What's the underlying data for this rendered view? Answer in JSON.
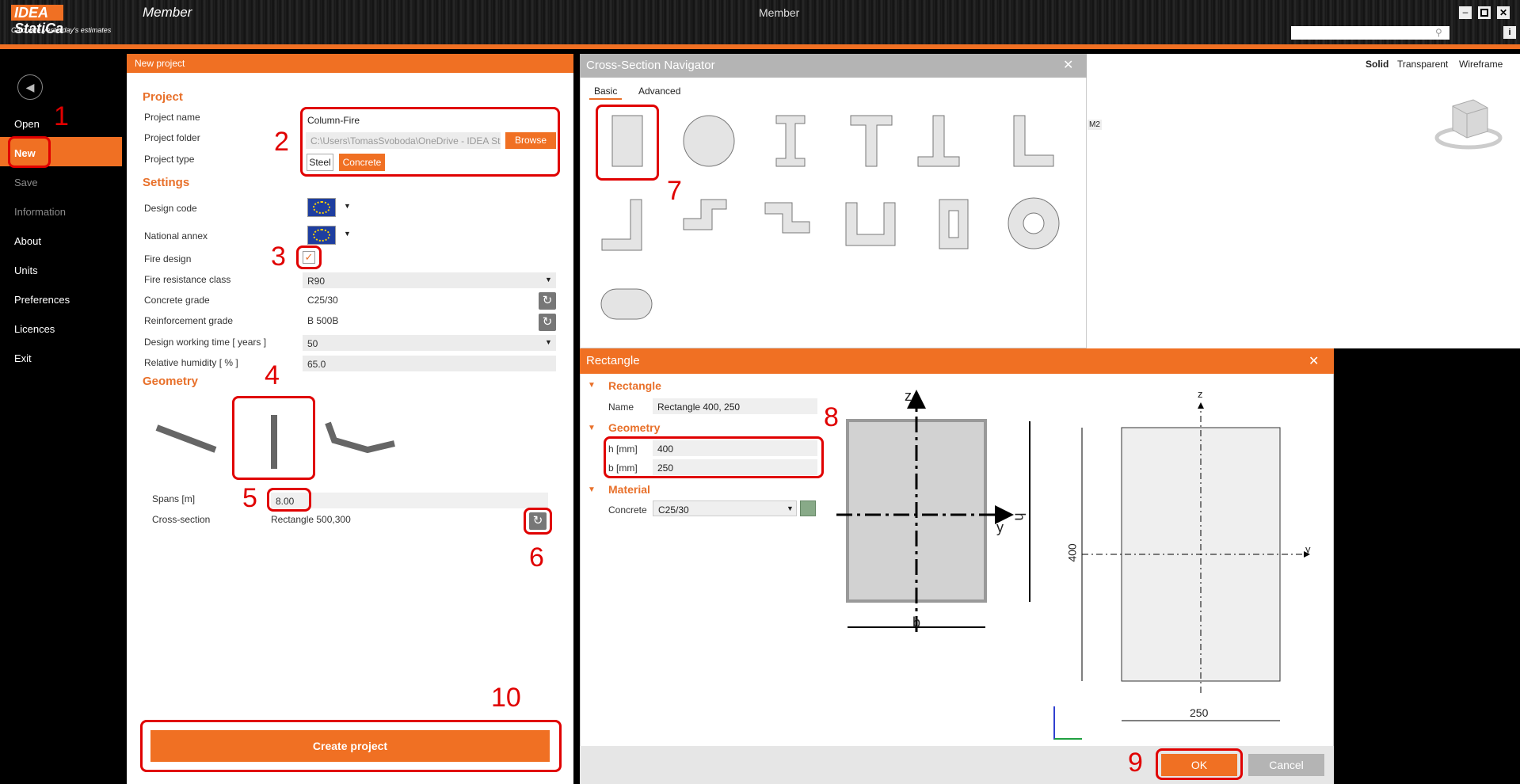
{
  "app": {
    "logo": "IDEA StatiCa",
    "module": "Member",
    "tagline": "Calculate yesterday's estimates",
    "window_title": "Member"
  },
  "sidebar": {
    "items": [
      {
        "label": "Open",
        "enabled": true
      },
      {
        "label": "New",
        "enabled": true,
        "selected": true
      },
      {
        "label": "Save",
        "enabled": false
      },
      {
        "label": "Information",
        "enabled": false
      },
      {
        "label": "About",
        "enabled": true
      },
      {
        "label": "Units",
        "enabled": true
      },
      {
        "label": "Preferences",
        "enabled": true
      },
      {
        "label": "Licences",
        "enabled": true
      },
      {
        "label": "Exit",
        "enabled": true
      }
    ]
  },
  "new_project": {
    "header": "New project",
    "project_section": "Project",
    "project_name_label": "Project name",
    "project_name": "Column-Fire",
    "project_folder_label": "Project folder",
    "project_folder": "C:\\Users\\TomasSvoboda\\OneDrive - IDEA St",
    "browse": "Browse",
    "project_type_label": "Project type",
    "type_steel": "Steel",
    "type_concrete": "Concrete",
    "settings_section": "Settings",
    "design_code_label": "Design code",
    "national_annex_label": "National annex",
    "fire_design_label": "Fire design",
    "fire_design_checked": true,
    "fire_class_label": "Fire resistance class",
    "fire_class": "R90",
    "concrete_grade_label": "Concrete grade",
    "concrete_grade": "C25/30",
    "reinforcement_grade_label": "Reinforcement grade",
    "reinforcement_grade": "B 500B",
    "working_time_label": "Design working time  [ years ]",
    "working_time": "50",
    "humidity_label": "Relative humidity  [ % ]",
    "humidity": "65.0",
    "geometry_section": "Geometry",
    "spans_label": "Spans  [m]",
    "spans": "8.00",
    "cross_section_label": "Cross-section",
    "cross_section": "Rectangle 500,300",
    "create": "Create project"
  },
  "navigator": {
    "title": "Cross-Section Navigator",
    "tabs": [
      "Basic",
      "Advanced"
    ]
  },
  "view_toolbar": [
    "Solid",
    "Transparent",
    "Wireframe"
  ],
  "view_label": "M2",
  "rectangle_dialog": {
    "title": "Rectangle",
    "sec_rectangle": "Rectangle",
    "name_label": "Name",
    "name": "Rectangle 400, 250",
    "sec_geometry": "Geometry",
    "h_label": "h [mm]",
    "h": "400",
    "b_label": "b [mm]",
    "b": "250",
    "sec_material": "Material",
    "concrete_label": "Concrete",
    "concrete": "C25/30",
    "ok": "OK",
    "cancel": "Cancel",
    "dim_h": "400",
    "dim_b": "250"
  },
  "callouts": [
    "1",
    "2",
    "3",
    "4",
    "5",
    "6",
    "7",
    "8",
    "9",
    "10"
  ],
  "colors": {
    "accent": "#f07023",
    "highlight": "#e00000"
  }
}
